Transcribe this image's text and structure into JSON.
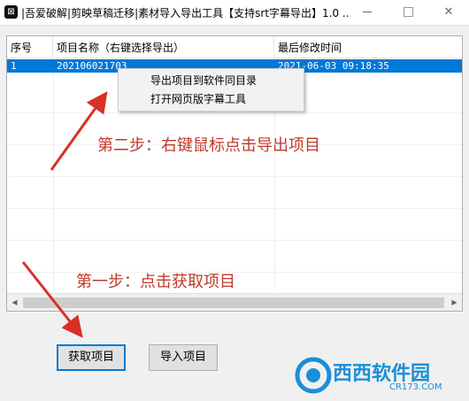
{
  "window": {
    "app_icon_glyph": "⊠",
    "title": "|吾爱破解|剪映草稿迁移|素材导入导出工具【支持srt字幕导出】1.0 ...",
    "minimize_icon": "minimize-icon",
    "maximize_icon": "maximize-icon",
    "close_glyph": "✕"
  },
  "table": {
    "columns": [
      "序号",
      "项目名称（右键选择导出）",
      "最后修改时间"
    ],
    "rows": [
      {
        "index": "1",
        "name": "202106021703",
        "modified": "2021-06-03 09:18:35",
        "selected": true
      }
    ]
  },
  "context_menu": {
    "items": [
      "导出项目到软件同目录",
      "打开网页版字幕工具"
    ]
  },
  "annotations": {
    "step2": "第二步：右键鼠标点击导出项目",
    "step1": "第一步：点击获取项目",
    "color": "#c0392b"
  },
  "buttons": {
    "fetch": "获取项目",
    "import": "导入项目"
  },
  "watermark": {
    "text": "西西软件园",
    "sub": "CR173.COM"
  },
  "colors": {
    "selection": "#0078d7",
    "accent_button_border": "#0078d7"
  }
}
